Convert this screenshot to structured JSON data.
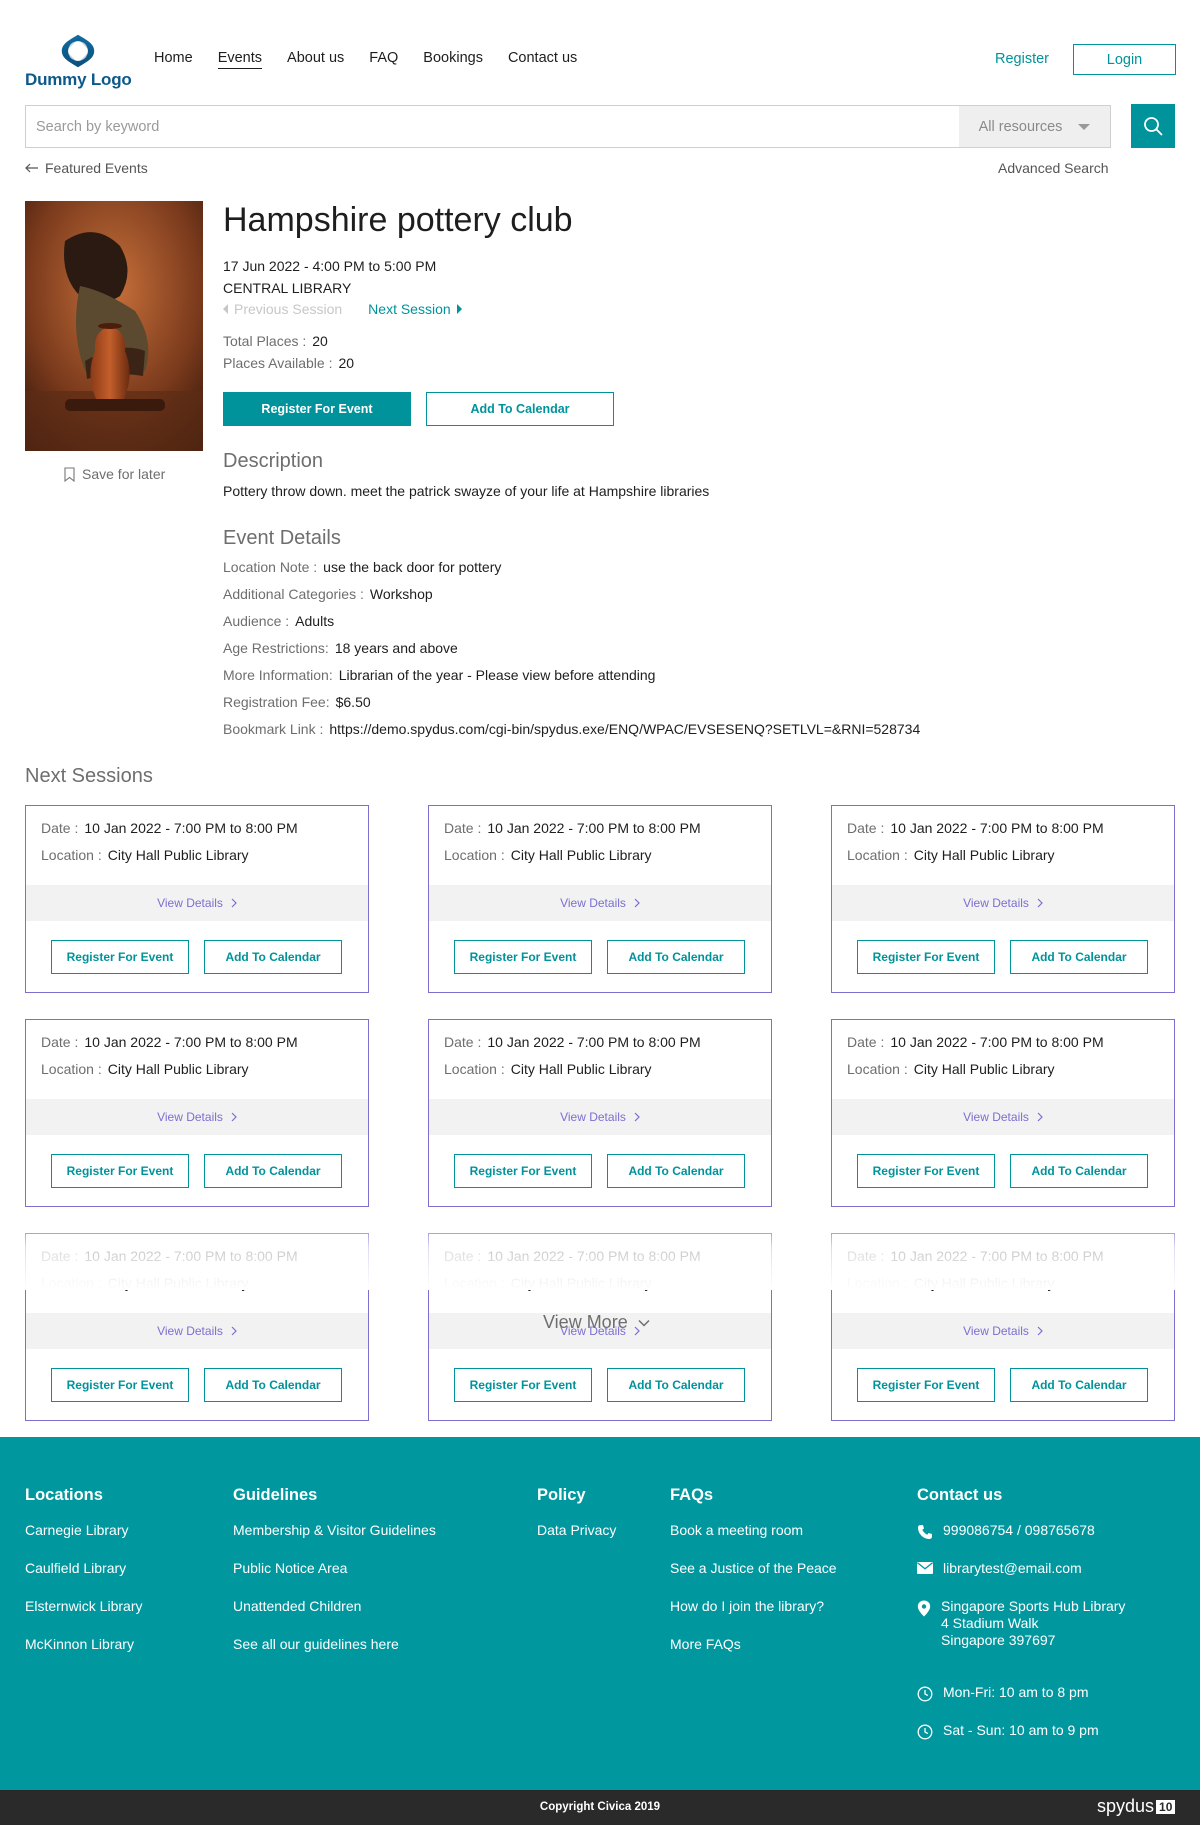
{
  "header": {
    "logo_text": "Dummy Logo",
    "nav": [
      "Home",
      "Events",
      "About us",
      "FAQ",
      "Bookings",
      "Contact us"
    ],
    "active_nav": "Events",
    "register": "Register",
    "login": "Login"
  },
  "search": {
    "placeholder": "Search by keyword",
    "scope": "All resources"
  },
  "breadcrumb": {
    "back": "Featured Events",
    "advanced": "Advanced Search"
  },
  "event": {
    "save_later": "Save for later",
    "title": "Hampshire pottery club",
    "datetime": "17 Jun 2022 - 4:00 PM to 5:00 PM",
    "location": "CENTRAL LIBRARY",
    "prev_session": "Previous Session",
    "next_session": "Next Session",
    "total_places_label": "Total Places :",
    "total_places": "20",
    "available_label": "Places Available :",
    "available": "20",
    "register_btn": "Register For Event",
    "calendar_btn": "Add To Calendar",
    "description_heading": "Description",
    "description": "Pottery throw down. meet the patrick swayze of your life at Hampshire libraries",
    "details_heading": "Event Details",
    "details": [
      {
        "label": "Location Note :",
        "value": "use the back door for pottery"
      },
      {
        "label": "Additional Categories :",
        "value": "Workshop"
      },
      {
        "label": "Audience :",
        "value": "Adults"
      },
      {
        "label": "Age Restrictions:",
        "value": "18 years and above"
      },
      {
        "label": "More Information:",
        "value": "Librarian of the year - Please view before attending"
      },
      {
        "label": "Registration Fee:",
        "value": "$6.50"
      },
      {
        "label": "Bookmark Link :",
        "value": "https://demo.spydus.com/cgi-bin/spydus.exe/ENQ/WPAC/EVSESENQ?SETLVL=&RNI=528734"
      }
    ]
  },
  "sessions": {
    "heading": "Next Sessions",
    "date_label": "Date :",
    "location_label": "Location :",
    "view_details": "View Details",
    "register_btn": "Register For Event",
    "calendar_btn": "Add To Calendar",
    "view_more": "View More",
    "items": [
      {
        "date": "10 Jan 2022 - 7:00 PM to 8:00 PM",
        "location": "City Hall Public Library"
      },
      {
        "date": "10 Jan 2022 - 7:00 PM to 8:00 PM",
        "location": "City Hall Public Library"
      },
      {
        "date": "10 Jan 2022 - 7:00 PM to 8:00 PM",
        "location": "City Hall Public Library"
      },
      {
        "date": "10 Jan 2022 - 7:00 PM to 8:00 PM",
        "location": "City Hall Public Library"
      },
      {
        "date": "10 Jan 2022 - 7:00 PM to 8:00 PM",
        "location": "City Hall Public Library"
      },
      {
        "date": "10 Jan 2022 - 7:00 PM to 8:00 PM",
        "location": "City Hall Public Library"
      },
      {
        "date": "10 Jan 2022 - 7:00 PM to 8:00 PM",
        "location": "City Hall Public Library"
      },
      {
        "date": "10 Jan 2022 - 7:00 PM to 8:00 PM",
        "location": "City Hall Public Library"
      },
      {
        "date": "10 Jan 2022 - 7:00 PM to 8:00 PM",
        "location": "City Hall Public Library"
      }
    ]
  },
  "footer": {
    "locations": {
      "heading": "Locations",
      "items": [
        "Carnegie Library",
        "Caulfield Library",
        "Elsternwick Library",
        "McKinnon Library"
      ]
    },
    "guidelines": {
      "heading": "Guidelines",
      "items": [
        "Membership & Visitor Guidelines",
        "Public Notice Area",
        "Unattended Children",
        "See all our guidelines here"
      ]
    },
    "policy": {
      "heading": "Policy",
      "items": [
        "Data Privacy"
      ]
    },
    "faqs": {
      "heading": "FAQs",
      "items": [
        "Book a meeting room",
        "See a Justice of the Peace",
        "How do I join the library?",
        "More FAQs"
      ]
    },
    "contact": {
      "heading": "Contact us",
      "phone": "999086754 / 098765678",
      "email": "librarytest@email.com",
      "address": [
        "Singapore Sports Hub Library",
        "4 Stadium Walk",
        "Singapore 397697"
      ],
      "hours_weekday": "Mon-Fri: 10 am to 8 pm",
      "hours_weekend": "Sat - Sun: 10 am to 9 pm"
    },
    "copyright": "Copyright Civica 2019",
    "brand": "spydus",
    "brand_version": "10"
  },
  "colors": {
    "accent": "#00939b",
    "card_border": "#7b6fd0",
    "footer_bg": "#00979f",
    "bottom_bar": "#2a2a2a"
  }
}
